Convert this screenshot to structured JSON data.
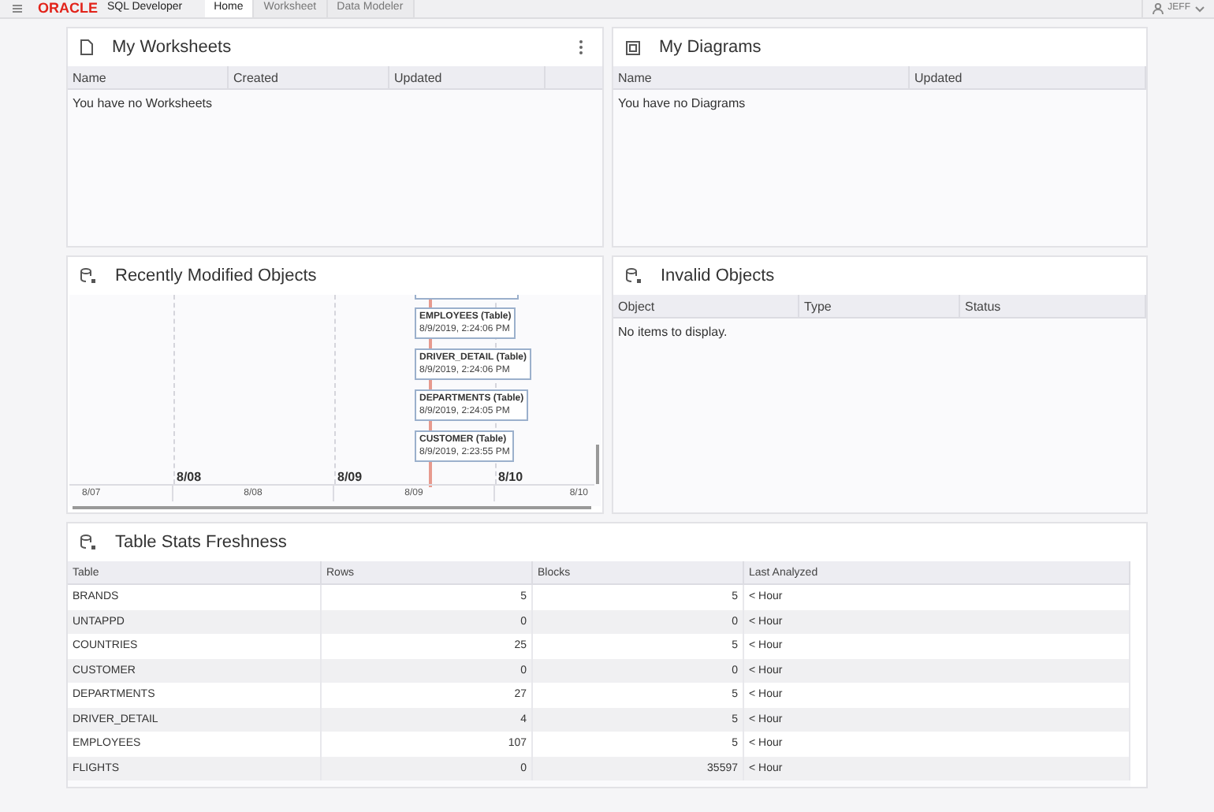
{
  "top_bar": {
    "logo": "ORACLE",
    "product": "SQL Developer",
    "tabs": [
      {
        "label": "Home",
        "selected": true
      },
      {
        "label": "Worksheet",
        "selected": false
      },
      {
        "label": "Data Modeler",
        "selected": false
      }
    ],
    "user": "JEFF"
  },
  "worksheets": {
    "title": "My Worksheets",
    "columns": [
      "Name",
      "Created",
      "Updated"
    ],
    "empty": "You have no Worksheets"
  },
  "diagrams": {
    "title": "My Diagrams",
    "columns": [
      "Name",
      "Updated"
    ],
    "empty": "You have no Diagrams"
  },
  "recent": {
    "title": "Recently Modified Objects",
    "events": [
      {
        "name": "EMPLOYEES (Table)",
        "time": "8/9/2019, 2:24:06 PM"
      },
      {
        "name": "DRIVER_DETAIL (Table)",
        "time": "8/9/2019, 2:24:06 PM"
      },
      {
        "name": "DEPARTMENTS (Table)",
        "time": "8/9/2019, 2:24:05 PM"
      },
      {
        "name": "CUSTOMER (Table)",
        "time": "8/9/2019, 2:23:55 PM"
      }
    ],
    "major_ticks": [
      "8/08",
      "8/09",
      "8/10"
    ],
    "minor_ticks": [
      "8/07",
      "8/08",
      "8/09",
      "8/10"
    ]
  },
  "invalid": {
    "title": "Invalid Objects",
    "columns": [
      "Object",
      "Type",
      "Status"
    ],
    "empty": "No items to display."
  },
  "freshness": {
    "title": "Table Stats Freshness",
    "columns": [
      "Table",
      "Rows",
      "Blocks",
      "Last Analyzed"
    ],
    "rows": [
      [
        "BRANDS",
        "5",
        "5",
        "< Hour"
      ],
      [
        "UNTAPPD",
        "0",
        "0",
        "< Hour"
      ],
      [
        "COUNTRIES",
        "25",
        "5",
        "< Hour"
      ],
      [
        "CUSTOMER",
        "0",
        "0",
        "< Hour"
      ],
      [
        "DEPARTMENTS",
        "27",
        "5",
        "< Hour"
      ],
      [
        "DRIVER_DETAIL",
        "4",
        "5",
        "< Hour"
      ],
      [
        "EMPLOYEES",
        "107",
        "5",
        "< Hour"
      ],
      [
        "FLIGHTS",
        "0",
        "35597",
        "< Hour"
      ]
    ]
  }
}
